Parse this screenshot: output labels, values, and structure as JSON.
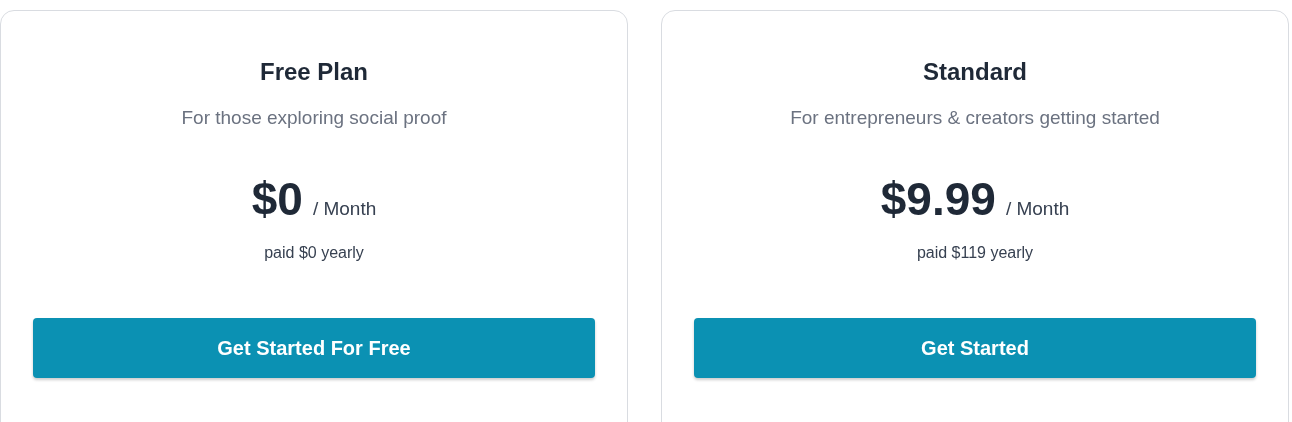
{
  "plans": [
    {
      "name": "Free Plan",
      "description": "For those exploring social proof",
      "price": "$0",
      "period": "/ Month",
      "billing": "paid $0 yearly",
      "button": "Get Started For Free"
    },
    {
      "name": "Standard",
      "description": "For entrepreneurs & creators getting started",
      "price": "$9.99",
      "period": "/ Month",
      "billing": "paid $119 yearly",
      "button": "Get Started"
    }
  ]
}
